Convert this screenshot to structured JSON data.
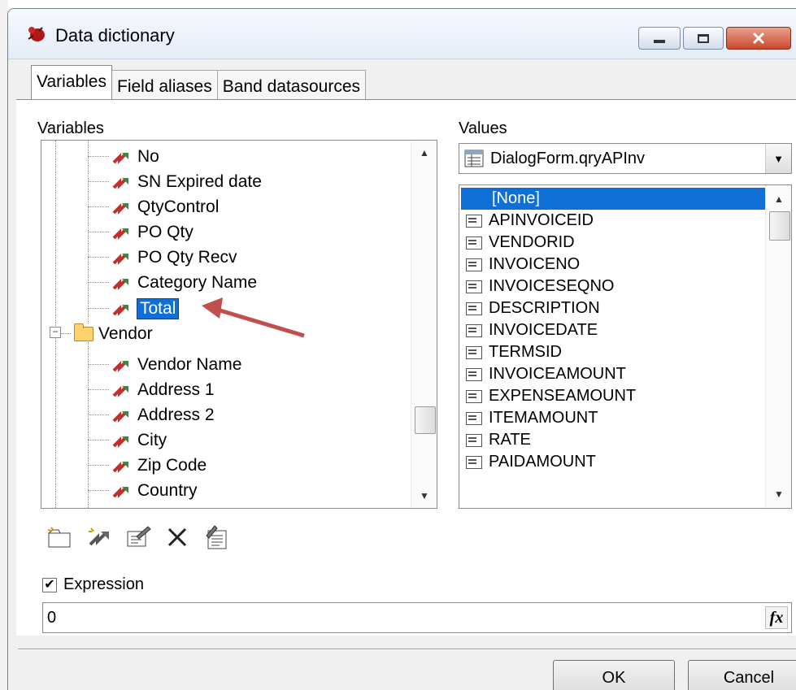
{
  "window": {
    "title": "Data dictionary",
    "caption_buttons": [
      "minimize",
      "maximize",
      "close"
    ]
  },
  "tabs": [
    {
      "label": "Variables",
      "active": true
    },
    {
      "label": "Field aliases",
      "active": false
    },
    {
      "label": "Band datasources",
      "active": false
    }
  ],
  "variables_panel": {
    "label": "Variables",
    "tree": [
      {
        "label": "No",
        "type": "variable"
      },
      {
        "label": "SN Expired date",
        "type": "variable"
      },
      {
        "label": "QtyControl",
        "type": "variable"
      },
      {
        "label": "PO Qty",
        "type": "variable"
      },
      {
        "label": "PO Qty Recv",
        "type": "variable"
      },
      {
        "label": "Category Name",
        "type": "variable"
      },
      {
        "label": "Total",
        "type": "variable",
        "editing": true
      },
      {
        "label": "Vendor",
        "type": "folder",
        "expanded": true
      },
      {
        "label": "Vendor Name",
        "type": "variable"
      },
      {
        "label": "Address 1",
        "type": "variable"
      },
      {
        "label": "Address 2",
        "type": "variable"
      },
      {
        "label": "City",
        "type": "variable"
      },
      {
        "label": "Zip Code",
        "type": "variable"
      },
      {
        "label": "Country",
        "type": "variable"
      }
    ],
    "toolbar_icons": [
      "new-category-icon",
      "new-variable-icon",
      "edit-icon",
      "delete-icon",
      "edit-list-icon"
    ]
  },
  "values_panel": {
    "label": "Values",
    "datasource": "DialogForm.qryAPInv",
    "fields": [
      {
        "label": "[None]",
        "selected": true
      },
      {
        "label": "APINVOICEID"
      },
      {
        "label": "VENDORID"
      },
      {
        "label": "INVOICENO"
      },
      {
        "label": "INVOICESEQNO"
      },
      {
        "label": "DESCRIPTION"
      },
      {
        "label": "INVOICEDATE"
      },
      {
        "label": "TERMSID"
      },
      {
        "label": "INVOICEAMOUNT"
      },
      {
        "label": "EXPENSEAMOUNT"
      },
      {
        "label": "ITEMAMOUNT"
      },
      {
        "label": "RATE"
      },
      {
        "label": "PAIDAMOUNT"
      }
    ]
  },
  "expression": {
    "label": "Expression",
    "checked": true,
    "value": "0",
    "fx_label": "fx"
  },
  "buttons": {
    "ok": "OK",
    "cancel": "Cancel"
  },
  "colors": {
    "selection": "#0f6fd6",
    "annotation_arrow": "#c0504d"
  }
}
